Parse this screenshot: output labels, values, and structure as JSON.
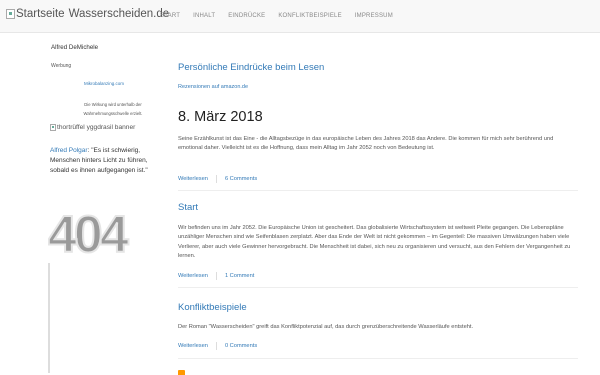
{
  "navbar": {
    "brand_alt": "Startseite",
    "brand_title": "Wasserscheiden.de",
    "items": [
      "START",
      "INHALT",
      "EINDRÜCKE",
      "KONFLIKTBEISPIELE",
      "IMPRESSUM"
    ]
  },
  "sidebar": {
    "author": "Alfred DeMichele",
    "ad_label": "Werbung",
    "ad_link": "Mikrobalanzing.com",
    "ad_note": "Die Wirkung wird unterhalb der Wahrnehmungsschwelle erzielt.",
    "banner_alt": "thortrüffel yggdrasil banner",
    "quote_author": "Alfred Polgar",
    "quote_text": ": \"Es ist schwierig, Menschen hinters Licht zu führen, sobald es ihnen aufgegangen ist.\"",
    "image_404": "404"
  },
  "main": {
    "heading": "Persönliche Eindrücke beim Lesen",
    "reviews_link": "Rezensionen auf amazon.de",
    "posts": [
      {
        "title": "8. März 2018",
        "body": "Seine Erzählkunst ist das Eine - die Alltagsbezüge in das europäische Leben des Jahres 2018 das Andere. Die kommen für mich sehr berührend und emotional daher. Vielleicht ist es die Hoffnung, dass mein Alltag im Jahr 2052 noch von Bedeutung ist.",
        "read_more": "Weiterlesen",
        "comments": "6 Comments"
      },
      {
        "title": "Start",
        "body": "Wir befinden uns im Jahr 2052. Die Europäische Union ist gescheitert. Das globalisierte Wirtschaftssystem ist weltweit Pleite gegangen. Die Lebenspläne unzähliger Menschen sind wie Seifenblasen zerplatzt. Aber das Ende der Welt ist nicht gekommen – im Gegenteil: Die massiven Umwälzungen haben viele Verlierer, aber auch viele Gewinner hervorgebracht. Die Menschheit ist dabei, sich neu zu organisieren und versucht, aus den Fehlern der Vergangenheit zu lernen.",
        "read_more": "Weiterlesen",
        "comments": "1 Comment"
      },
      {
        "title": "Konfliktbeispiele",
        "body": "Der Roman \"Wasserscheiden\" greift das Konfliktpotenzial auf, das durch grenzüberschreitende Wasserläufe entsteht.",
        "read_more": "Weiterlesen",
        "comments": "0 Comments"
      }
    ]
  },
  "colors": {
    "link": "#337ab7",
    "navbar_bg": "#f8f8f8",
    "rss": "#ff9900"
  }
}
